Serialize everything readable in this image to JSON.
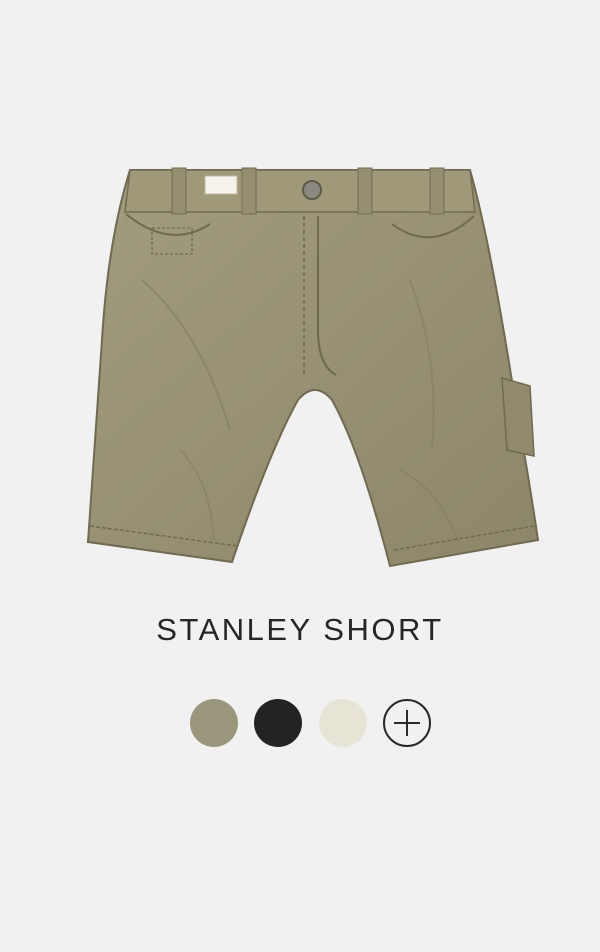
{
  "product": {
    "title": "STANLEY SHORT",
    "image_icon": "shorts-image",
    "swatches": [
      {
        "name": "olive-swatch",
        "color": "#9b977d"
      },
      {
        "name": "black-swatch",
        "color": "#232323"
      },
      {
        "name": "cream-swatch",
        "color": "#e8e4d5"
      }
    ],
    "more_colors_icon": "plus-icon"
  },
  "colors": {
    "background": "#f1f1f1",
    "short_fabric": "#9b9476",
    "short_shadow": "#7f7a5f",
    "title_text": "#262626"
  }
}
